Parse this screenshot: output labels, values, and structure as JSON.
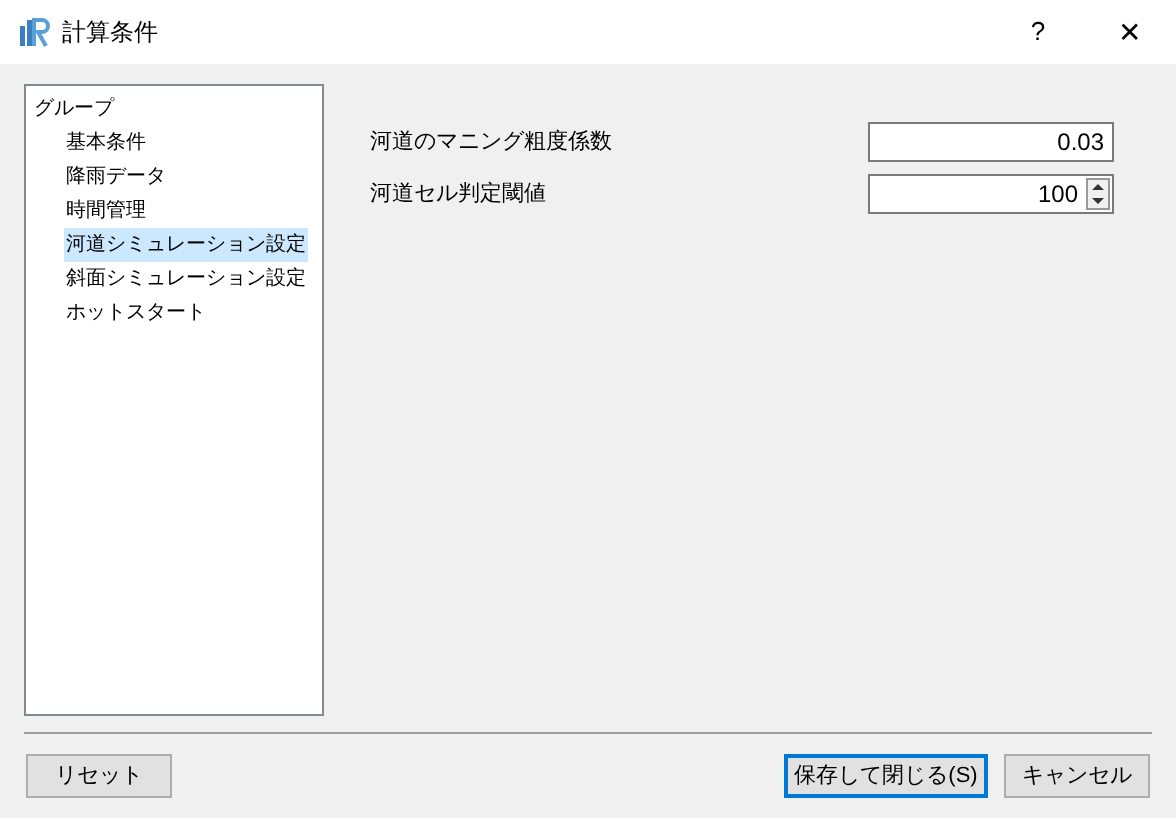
{
  "window": {
    "title": "計算条件",
    "help": "?",
    "close": "✕"
  },
  "tree": [
    {
      "label": "グループ",
      "selected": false,
      "children": [
        {
          "label": "基本条件",
          "selected": false
        },
        {
          "label": "降雨データ",
          "selected": false
        },
        {
          "label": "時間管理",
          "selected": false
        },
        {
          "label": "河道シミュレーション設定",
          "selected": true
        },
        {
          "label": "斜面シミュレーション設定",
          "selected": false
        },
        {
          "label": "ホットスタート",
          "selected": false
        }
      ]
    }
  ],
  "fields": [
    {
      "kind": "text",
      "label": "河道のマニング粗度係数",
      "value": "0.03"
    },
    {
      "kind": "spin",
      "label": "河道セル判定閾値",
      "value": "100"
    }
  ],
  "buttons": [
    {
      "label": "リセット",
      "default": false
    },
    {
      "label": "保存して閉じる(S)",
      "default": true
    },
    {
      "label": "キャンセル",
      "default": false
    }
  ]
}
